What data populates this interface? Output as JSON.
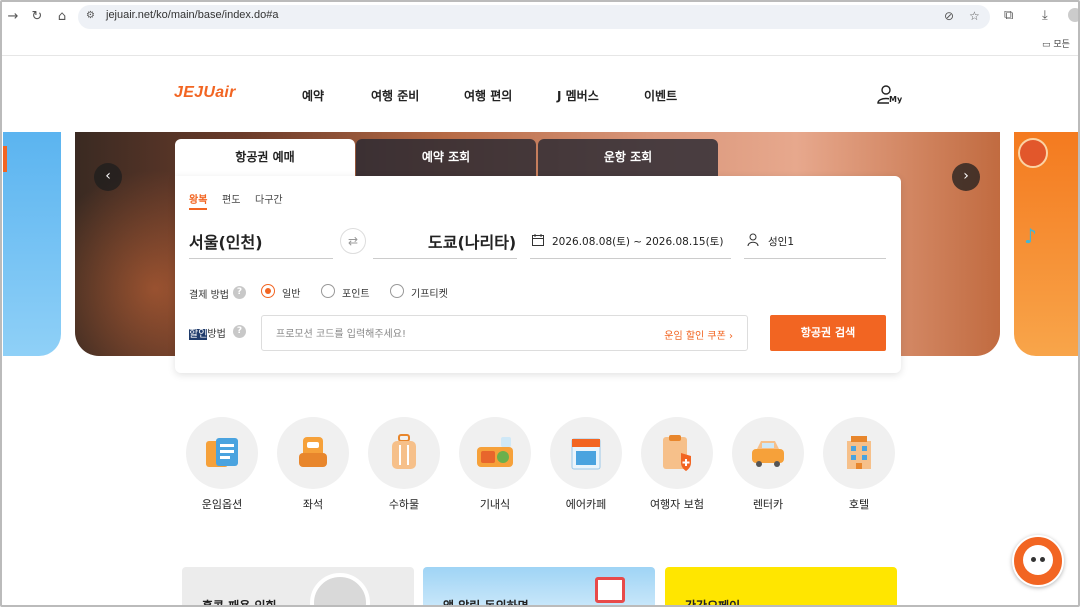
{
  "browser": {
    "url": "jejuair.net/ko/main/base/index.do#a",
    "bookmark_label": "모든"
  },
  "header": {
    "logo": "JEJUair",
    "nav": [
      "예약",
      "여행 준비",
      "여행 편의",
      "J 멤버스",
      "이벤트"
    ],
    "my_label": "My"
  },
  "booking": {
    "tabs": [
      "항공권 예매",
      "예약 조회",
      "운항 조회"
    ],
    "trip_types": [
      "왕복",
      "편도",
      "다구간"
    ],
    "origin": "서울(인천)",
    "destination": "도쿄(나리타)",
    "dates": "2026.08.08(토) ~ 2026.08.15(토)",
    "passengers": "성인1",
    "payment_label": "결제 방법",
    "payment_options": [
      "일반",
      "포인트",
      "기프티켓"
    ],
    "discount_label_highlight": "할인",
    "discount_label_rest": "방법",
    "promo_placeholder": "프로모션 코드를 입력해주세요!",
    "coupon_link": "운임 할인 쿠폰",
    "search_button": "항공권 검색",
    "help_mark": "?"
  },
  "quick_menu": [
    "운임옵션",
    "좌석",
    "수하물",
    "기내식",
    "에어카페",
    "여행자 보험",
    "렌터카",
    "호텔"
  ],
  "banners": [
    "홍콩 패용 익힘",
    "앱 알림 동의하면",
    "간간요페이"
  ],
  "colors": {
    "brand_orange": "#f26522"
  }
}
